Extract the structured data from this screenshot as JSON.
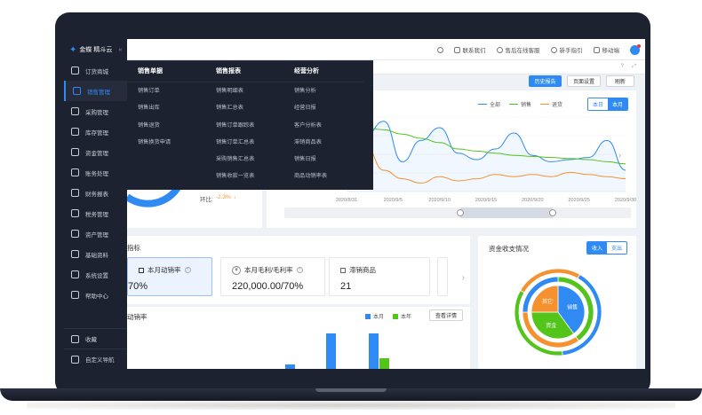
{
  "brand": {
    "name": "金蝶 精斗云"
  },
  "topbar": {
    "contact": "联系我们",
    "service": "售后在线客服",
    "guide": "新手指引",
    "mobile": "移动端"
  },
  "sidebar": {
    "items": [
      {
        "label": "订货商城",
        "icon": "cart-icon"
      },
      {
        "label": "销售管理",
        "icon": "chart-icon"
      },
      {
        "label": "采购管理",
        "icon": "bag-icon"
      },
      {
        "label": "库存管理",
        "icon": "box-icon"
      },
      {
        "label": "资金管理",
        "icon": "money-icon"
      },
      {
        "label": "账务处理",
        "icon": "yuan-icon"
      },
      {
        "label": "财务报表",
        "icon": "report-icon"
      },
      {
        "label": "税务管理",
        "icon": "tax-icon"
      },
      {
        "label": "资产管理",
        "icon": "house-icon"
      },
      {
        "label": "基础资料",
        "icon": "layers-icon"
      },
      {
        "label": "系统设置",
        "icon": "gear-icon"
      },
      {
        "label": "帮助中心",
        "icon": "help-icon"
      }
    ],
    "bottom": [
      {
        "label": "收藏",
        "icon": "star-icon"
      },
      {
        "label": "自定义导航",
        "icon": "menu-icon"
      }
    ]
  },
  "mega_menu": {
    "columns": [
      {
        "title": "销售单据",
        "links": [
          "销售订单",
          "销售出库",
          "销售退货",
          "销售换货申请"
        ]
      },
      {
        "title": "销售报表",
        "links": [
          "销售明细表",
          "销售汇总表",
          "销售订单跟踪表",
          "销售订单汇总表",
          "采购销售汇总表",
          "销售收款一览表"
        ]
      },
      {
        "title": "经营分析",
        "links": [
          "销售分析",
          "经营日报",
          "客户分析表",
          "滞销商品表",
          "销售日报",
          "商品动销率表"
        ]
      }
    ]
  },
  "toolbar": {
    "history": "历史报告",
    "page_settings": "页面设置",
    "refresh": "刷新"
  },
  "trend_chart": {
    "legend": [
      "全部",
      "销售",
      "退货"
    ],
    "toggle": [
      "本日",
      "本月"
    ],
    "x_labels": [
      "2020/8/31",
      "2020/9/5",
      "2020/9/10",
      "2020/9/15",
      "2020/9/20",
      "2020/9/25",
      "2020/9/30"
    ],
    "ratio_label": "环比:",
    "ratio_value": "-2.3%",
    "ratio_arrow": "↓"
  },
  "indicators": {
    "title": "指标",
    "cards": [
      {
        "title": "本月动销率",
        "value": "70%"
      },
      {
        "title": "本月毛利/毛利率",
        "value": "220,000.00/70%"
      },
      {
        "title": "滞销商品",
        "value": "21"
      }
    ]
  },
  "sales_rate": {
    "title": "动销率",
    "legend": [
      "本月",
      "本年"
    ],
    "button": "查看详情"
  },
  "fund": {
    "title": "资金收支情况",
    "toggle": [
      "收入",
      "支出"
    ],
    "slices": [
      "销售",
      "资金",
      "其它"
    ]
  },
  "colors": {
    "accent": "#2f8af3",
    "green": "#52c41a",
    "orange": "#f5922f",
    "dark": "#1d2230"
  },
  "chart_data": [
    {
      "type": "line",
      "x": [
        "2020/8/31",
        "2020/9/5",
        "2020/9/10",
        "2020/9/15",
        "2020/9/20",
        "2020/9/25",
        "2020/9/30"
      ],
      "series": [
        {
          "name": "全部",
          "values": [
            44,
            52,
            66,
            28,
            48,
            60,
            36,
            30,
            40,
            55,
            34,
            28,
            30,
            32,
            48,
            20
          ]
        },
        {
          "name": "销售",
          "values": [
            52,
            60,
            58,
            54,
            50,
            46,
            40,
            38,
            36,
            34,
            33,
            32,
            31,
            30,
            28,
            26
          ]
        },
        {
          "name": "退货",
          "values": [
            48,
            44,
            20,
            12,
            8,
            14,
            10,
            12,
            16,
            14,
            16,
            14,
            18,
            16,
            14,
            12
          ]
        }
      ]
    },
    {
      "type": "bar",
      "title": "动销率",
      "series": [
        {
          "name": "本月",
          "values": [
            5,
            40,
            40
          ]
        },
        {
          "name": "本年",
          "values": [
            0,
            0,
            12
          ]
        }
      ]
    },
    {
      "type": "pie",
      "title": "资金收支情况",
      "categories": [
        "销售",
        "资金",
        "其它"
      ],
      "values": [
        40,
        35,
        25
      ]
    }
  ]
}
